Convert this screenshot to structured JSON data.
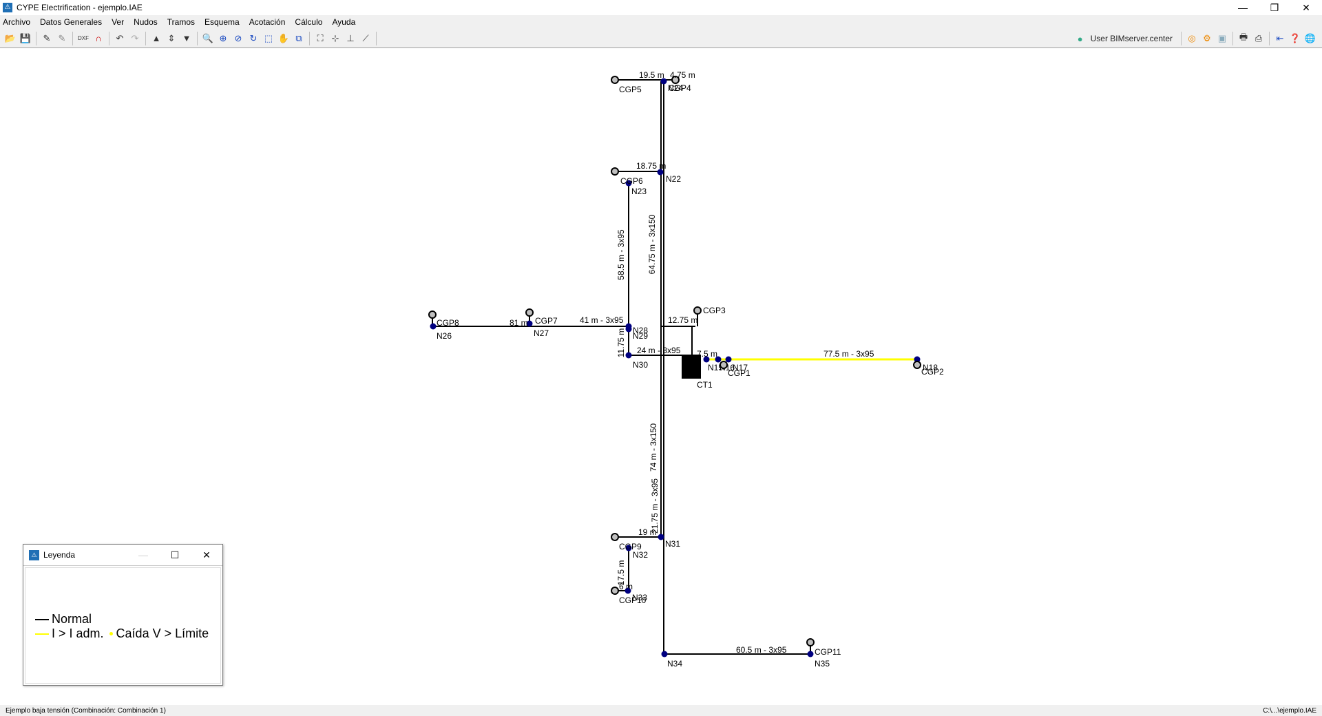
{
  "window": {
    "title": "CYPE Electrification - ejemplo.IAE"
  },
  "menu": [
    "Archivo",
    "Datos Generales",
    "Ver",
    "Nudos",
    "Tramos",
    "Esquema",
    "Acotación",
    "Cálculo",
    "Ayuda"
  ],
  "toolbar": {
    "user_label": "User BIMserver.center"
  },
  "colors": {
    "normal": "#000000",
    "overload": "#ffff00",
    "node": "#000080",
    "cgp": "#c0c0c0"
  },
  "nodes": [
    "N22",
    "N23",
    "N24",
    "N26",
    "N27",
    "N28",
    "N29",
    "N30",
    "N31",
    "N32",
    "N33",
    "N34",
    "N35",
    "N15",
    "N16",
    "N17",
    "N18",
    "CGP1",
    "CGP2",
    "CGP3",
    "CGP4",
    "CGP5",
    "CGP6",
    "CGP7",
    "CGP8",
    "CGP9",
    "CGP10",
    "CGP11",
    "CT1"
  ],
  "segments": [
    "19.5 m",
    "4.75 m",
    "18.75 m",
    "58.5 m - 3x95",
    "64.75 m - 3x150",
    "74 m - 3x150",
    "21.75 m - 3x95",
    "19 m",
    "17.5 m",
    "6 m",
    "60.5 m - 3x95",
    "77.5 m - 3x95",
    "41 m - 3x95",
    "81 m",
    "11.75 m",
    "24 m - 3x95",
    "12.75 m",
    "7.5 m"
  ],
  "legend": {
    "title": "Leyenda",
    "normal": "Normal",
    "overload": "I > I adm.",
    "voltage_drop": "Caída V > Límite"
  },
  "status": {
    "left": "Ejemplo baja tensión (Combinación: Combinación 1)",
    "right": "C:\\...\\ejemplo.IAE"
  }
}
